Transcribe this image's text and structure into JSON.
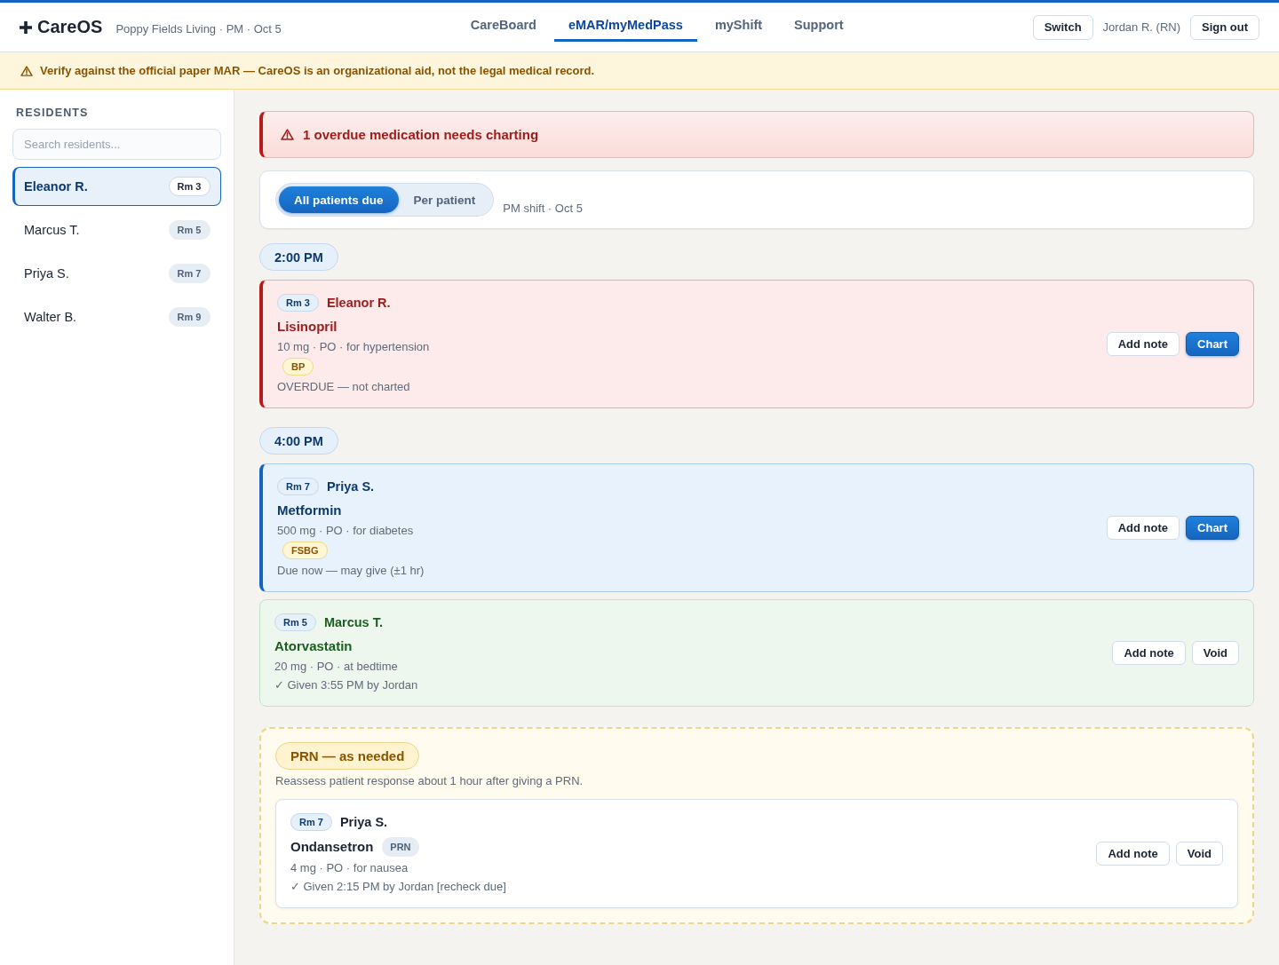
{
  "header": {
    "logo": "CareOS",
    "facility": "Poppy Fields Living · PM · Oct 5",
    "nav": [
      {
        "label": "CareBoard",
        "selected": false
      },
      {
        "label": "eMAR/myMedPass",
        "selected": true
      },
      {
        "label": "myShift",
        "selected": false
      },
      {
        "label": "Support",
        "selected": false
      }
    ],
    "switch_button": "Switch",
    "user": "Jordan R. (RN)",
    "sign_out_button": "Sign out"
  },
  "disclaimer": "Verify against the official paper MAR — CareOS is an organizational aid, not the legal medical record.",
  "sidebar": {
    "heading": "RESIDENTS",
    "search": {
      "placeholder": "Search residents..."
    },
    "residents": [
      {
        "name": "Eleanor R.",
        "room": "Rm 3",
        "selected": true
      },
      {
        "name": "Marcus T.",
        "room": "Rm 5",
        "selected": false
      },
      {
        "name": "Priya S.",
        "room": "Rm 7",
        "selected": false
      },
      {
        "name": "Walter B.",
        "room": "Rm 9",
        "selected": false
      }
    ]
  },
  "alert": "1 overdue medication needs charting",
  "view_toggle": {
    "options": [
      {
        "label": "All patients due",
        "selected": true
      },
      {
        "label": "Per patient",
        "selected": false
      }
    ],
    "shift": "PM shift · Oct 5"
  },
  "time_groups": [
    {
      "time": "2:00 PM",
      "doses": [
        {
          "kind": "overdue",
          "room": "Rm 3",
          "resident": "Eleanor R.",
          "medication": "Lisinopril",
          "details": "10 mg · PO · for hypertension",
          "tags": [
            {
              "label": "BP",
              "kind": "check"
            }
          ],
          "status_text": "OVERDUE — not charted",
          "actions": [
            {
              "label": "Add note",
              "kind": "secondary"
            },
            {
              "label": "Chart",
              "kind": "primary"
            }
          ]
        }
      ]
    },
    {
      "time": "4:00 PM",
      "doses": [
        {
          "kind": "due",
          "room": "Rm 7",
          "resident": "Priya S.",
          "medication": "Metformin",
          "details": "500 mg · PO · for diabetes",
          "tags": [
            {
              "label": "FSBG",
              "kind": "check"
            }
          ],
          "status_text": "Due now — may give (±1 hr)",
          "actions": [
            {
              "label": "Add note",
              "kind": "secondary"
            },
            {
              "label": "Chart",
              "kind": "primary"
            }
          ]
        },
        {
          "kind": "given",
          "room": "Rm 5",
          "resident": "Marcus T.",
          "medication": "Atorvastatin",
          "details": "20 mg · PO · at bedtime",
          "status_text": "✓ Given 3:55 PM by Jordan",
          "actions": [
            {
              "label": "Add note",
              "kind": "secondary"
            },
            {
              "label": "Void",
              "kind": "secondary"
            }
          ]
        }
      ]
    }
  ],
  "prn": {
    "title": "PRN — as needed",
    "note": "Reassess patient response about 1 hour after giving a PRN.",
    "doses": [
      {
        "kind": "prn",
        "room": "Rm 7",
        "resident": "Priya S.",
        "medication": "Ondansetron",
        "tags": [
          {
            "label": "PRN",
            "kind": "prn"
          }
        ],
        "details": "4 mg · PO · for nausea",
        "status_text": "✓ Given 2:15 PM by Jordan [recheck due]",
        "actions": [
          {
            "label": "Add note",
            "kind": "secondary"
          },
          {
            "label": "Void",
            "kind": "secondary"
          }
        ]
      }
    ]
  }
}
